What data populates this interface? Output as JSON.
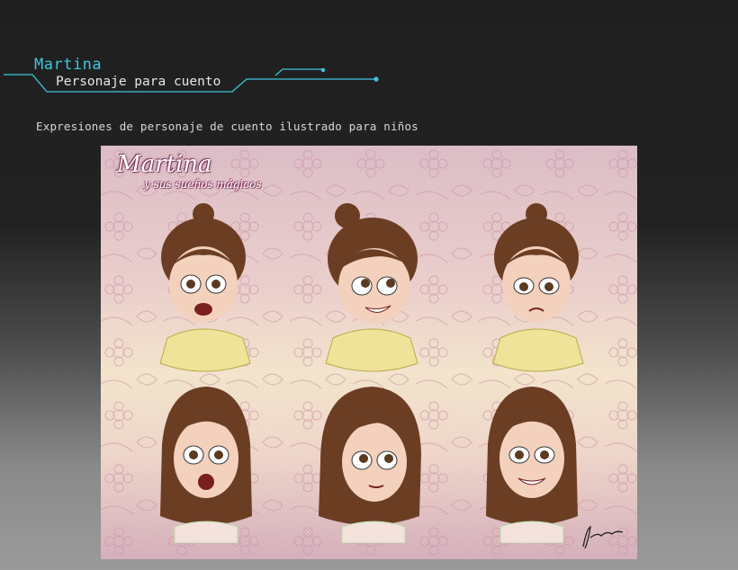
{
  "header": {
    "title": "Martina",
    "subtitle": "Personaje para cuento"
  },
  "description": "Expresiones de personaje de cuento ilustrado para niños",
  "artwork": {
    "logo_title": "Martina",
    "logo_subtitle": "y sus sueños mágicos",
    "expressions": [
      {
        "hair": "bun",
        "mood": "surprised"
      },
      {
        "hair": "bun",
        "mood": "smiling"
      },
      {
        "hair": "bun",
        "mood": "worried"
      },
      {
        "hair": "loose",
        "mood": "shocked"
      },
      {
        "hair": "loose",
        "mood": "calm"
      },
      {
        "hair": "loose",
        "mood": "grinning"
      }
    ]
  },
  "colors": {
    "accent": "#3cc7e0",
    "hair": "#6b3e24",
    "skin": "#f3d1bd",
    "dress": "#efe39a"
  }
}
